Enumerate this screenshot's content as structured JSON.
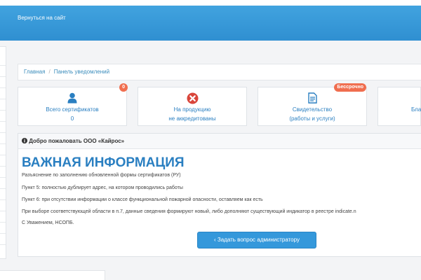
{
  "header": {
    "back_link": "Вернуться на сайт"
  },
  "breadcrumb": {
    "home": "Главная",
    "current": "Панель уведомлений"
  },
  "cards": [
    {
      "line1": "Всего сертификатов",
      "line2": "0",
      "badge": "0",
      "icon": "user-icon"
    },
    {
      "line1": "На продукцию",
      "line2": "не аккредитованы",
      "icon": "close-circle-icon"
    },
    {
      "line1": "Свидетельство",
      "line2": "(работы и услуги)",
      "badge": "Бессрочно",
      "icon": "document-icon"
    },
    {
      "line1": "Бла",
      "icon": ""
    }
  ],
  "panel": {
    "heading": "Добро пожаловать ООО «Кайрос»",
    "title": "ВАЖНАЯ ИНФОРМАЦИЯ",
    "lines": [
      "Разъяснение по заполнению обновленной формы сертификатов (РУ)",
      "Пункт 5: полностью дублирует адрес, на котором проводились работы",
      "Пункт 6: при отсутствии информации о классе функциональной пожарной опасности, оставляем как есть",
      "При выборе соответствующей области в п.7, данные сведения формируют новый, либо дополняют существующий индикатор в реестре indicate.n",
      "С Уважением, НСОПБ."
    ],
    "button": "Задать вопрос администратору"
  },
  "colors": {
    "accent": "#2a7fc1",
    "header": "#3597d8",
    "badge": "#f06e4f",
    "danger": "#d9453a"
  }
}
